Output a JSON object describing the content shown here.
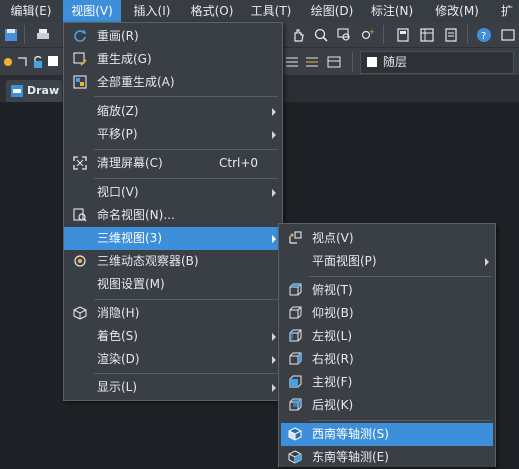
{
  "menubar": {
    "items": [
      {
        "label": "编辑(E)"
      },
      {
        "label": "视图(V)"
      },
      {
        "label": "插入(I)"
      },
      {
        "label": "格式(O)"
      },
      {
        "label": "工具(T)"
      },
      {
        "label": "绘图(D)"
      },
      {
        "label": "标注(N)"
      },
      {
        "label": "修改(M)"
      },
      {
        "label": "扩"
      }
    ]
  },
  "layer": {
    "value": "随层"
  },
  "doc_tab": {
    "label": "Draw"
  },
  "view_menu": {
    "items": [
      {
        "label": "重画(R)",
        "icon": "redraw-icon"
      },
      {
        "label": "重生成(G)",
        "icon": "regen-icon"
      },
      {
        "label": "全部重生成(A)",
        "icon": "regen-all-icon"
      },
      {
        "label": "缩放(Z)"
      },
      {
        "label": "平移(P)"
      },
      {
        "label": "清理屏幕(C)",
        "shortcut": "Ctrl+0",
        "icon": "clean-screen-icon"
      },
      {
        "label": "视口(V)"
      },
      {
        "label": "命名视图(N)...",
        "icon": "named-view-icon"
      },
      {
        "label": "三维视图(3)"
      },
      {
        "label": "三维动态观察器(B)",
        "icon": "orbit-icon"
      },
      {
        "label": "视图设置(M)"
      },
      {
        "label": "消隐(H)",
        "icon": "hide-icon"
      },
      {
        "label": "着色(S)"
      },
      {
        "label": "渲染(D)"
      },
      {
        "label": "显示(L)"
      }
    ]
  },
  "view3d_menu": {
    "items": [
      {
        "label": "视点(V)",
        "icon": "viewpoint-icon"
      },
      {
        "label": "平面视图(P)"
      },
      {
        "label": "俯视(T)",
        "icon": "top-view-icon"
      },
      {
        "label": "仰视(B)",
        "icon": "bottom-view-icon"
      },
      {
        "label": "左视(L)",
        "icon": "left-view-icon"
      },
      {
        "label": "右视(R)",
        "icon": "right-view-icon"
      },
      {
        "label": "主视(F)",
        "icon": "front-view-icon"
      },
      {
        "label": "后视(K)",
        "icon": "back-view-icon"
      },
      {
        "label": "西南等轴测(S)",
        "icon": "sw-iso-icon"
      },
      {
        "label": "东南等轴测(E)",
        "icon": "se-iso-icon"
      }
    ]
  },
  "colors": {
    "accent": "#3c8fd8",
    "menu_bg": "#3a3f46",
    "canvas_bg": "#1e2226"
  }
}
